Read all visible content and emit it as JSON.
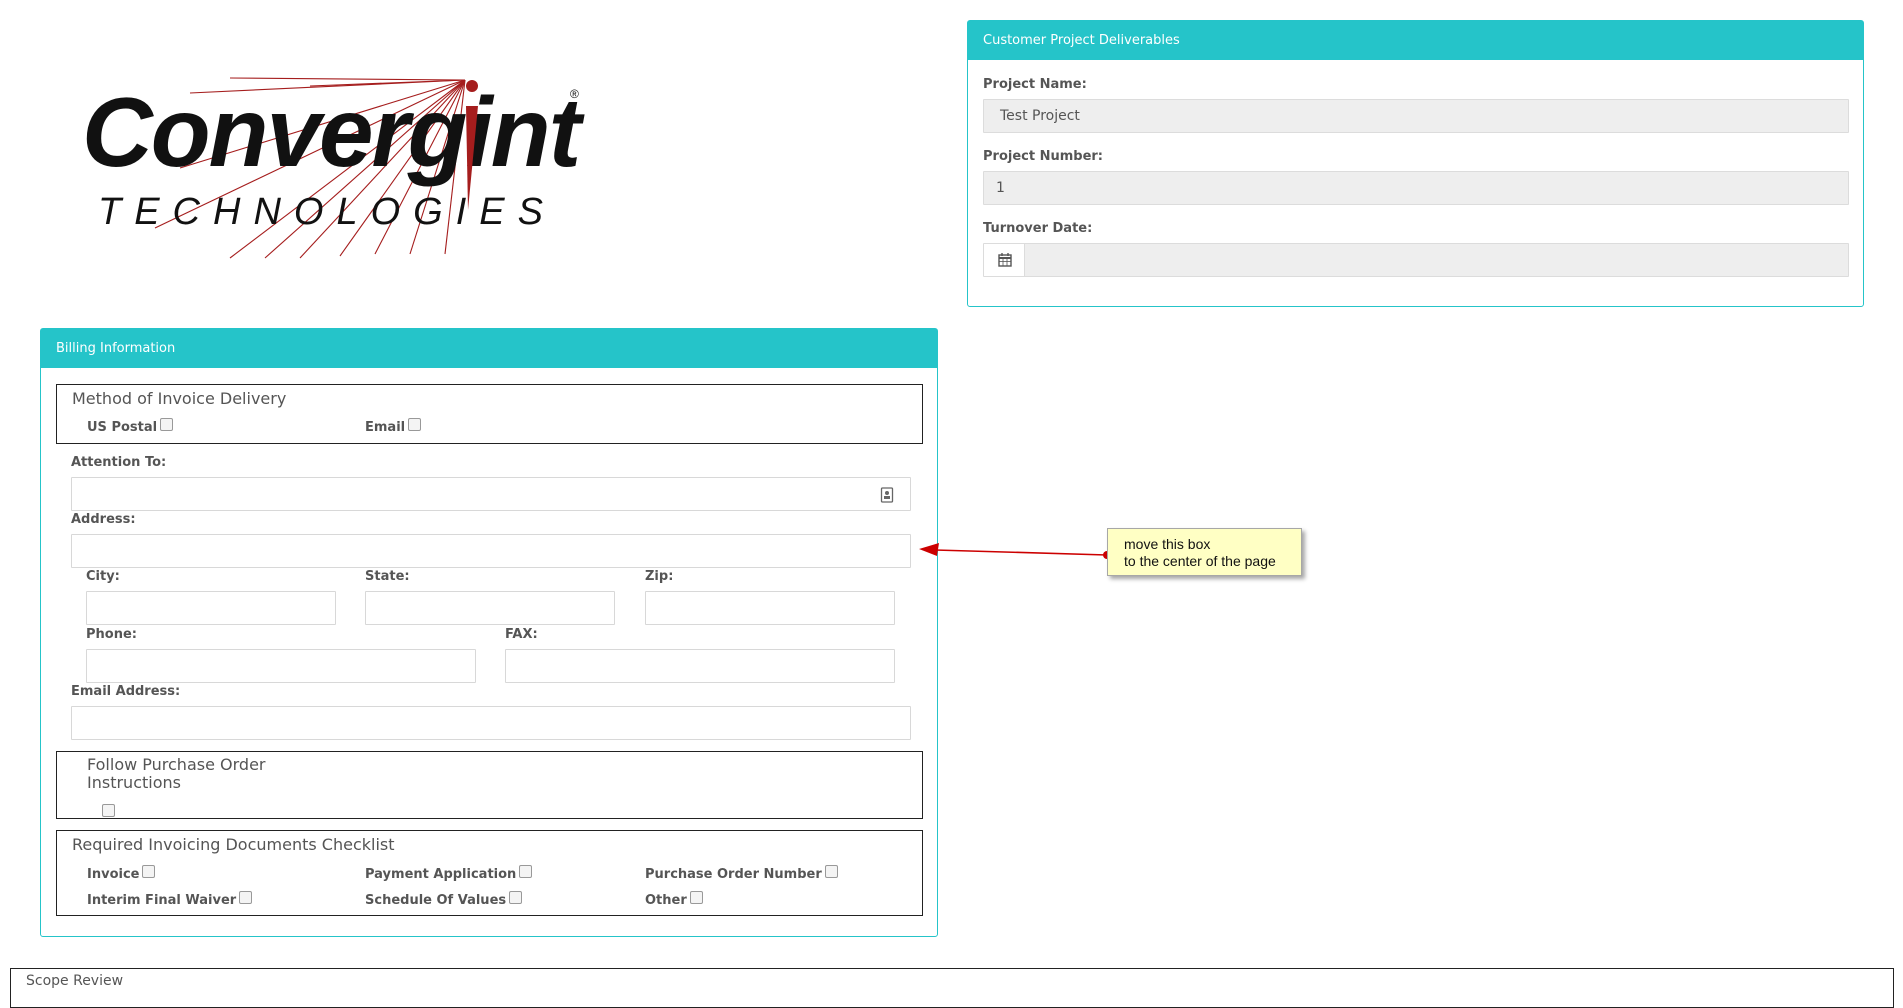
{
  "logo": {
    "word": "Convergint",
    "sub": "TECHNOLOGIES",
    "registered": "®"
  },
  "customer_project": {
    "title": "Customer Project Deliverables",
    "project_name_label": "Project Name:",
    "project_name_value": "Test Project",
    "project_number_label": "Project Number:",
    "project_number_value": "1",
    "turnover_date_label": "Turnover Date:",
    "turnover_date_value": ""
  },
  "billing": {
    "title": "Billing Information",
    "delivery": {
      "legend": "Method of Invoice Delivery",
      "us_postal": "US Postal",
      "email": "Email"
    },
    "attention_label": "Attention To:",
    "address_label": "Address:",
    "city_label": "City:",
    "state_label": "State:",
    "zip_label": "Zip:",
    "phone_label": "Phone:",
    "fax_label": "FAX:",
    "email_address_label": "Email Address:",
    "po_instructions_legend": "Follow Purchase Order Instructions",
    "checklist": {
      "legend": "Required Invoicing Documents Checklist",
      "invoice": "Invoice",
      "payment_application": "Payment Application",
      "purchase_order_number": "Purchase Order Number",
      "interim_final_waiver": "Interim Final Waiver",
      "schedule_of_values": "Schedule Of Values",
      "other": "Other"
    }
  },
  "annotation": {
    "line1": "move this box",
    "line2": "to the center of the page"
  },
  "scope_review": {
    "title": "Scope Review"
  },
  "colors": {
    "accent": "#25c4c9",
    "note_bg": "#ffffc4",
    "arrow": "#cc0000"
  }
}
